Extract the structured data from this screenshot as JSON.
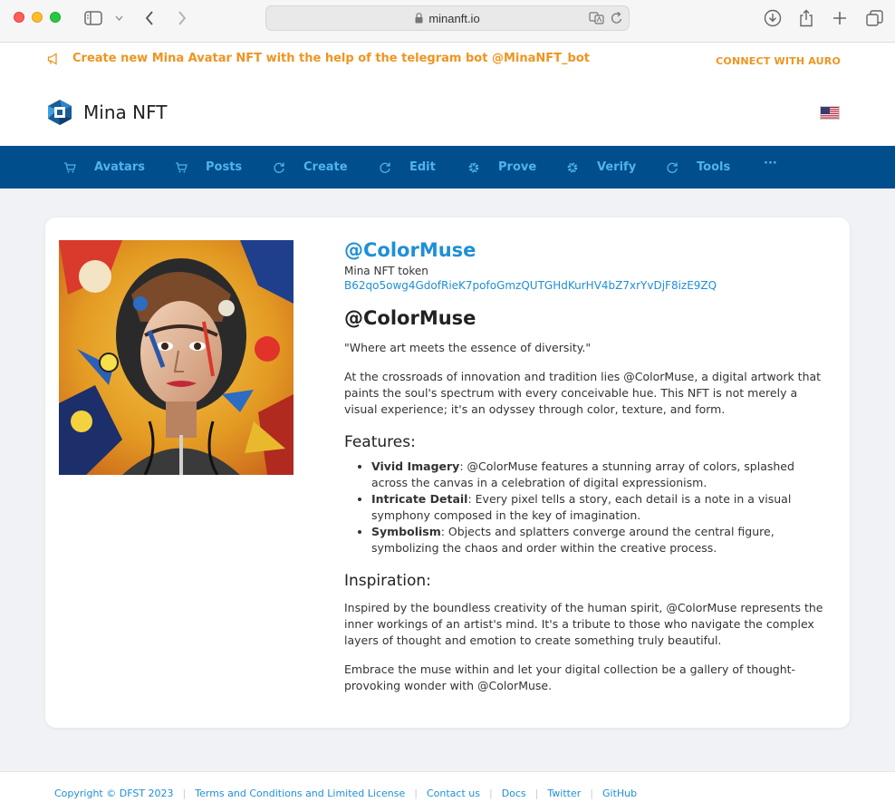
{
  "browser": {
    "url": "minanft.io"
  },
  "banner": {
    "announcement": "Create new Mina Avatar NFT with the help of the telegram bot @MinaNFT_bot",
    "connect_label": "CONNECT WITH AURO",
    "site_name": "Mina NFT"
  },
  "nav": {
    "items": [
      {
        "label": "Avatars",
        "icon": "cart-icon"
      },
      {
        "label": "Posts",
        "icon": "cart-icon"
      },
      {
        "label": "Create",
        "icon": "refresh-icon"
      },
      {
        "label": "Edit",
        "icon": "refresh-icon"
      },
      {
        "label": "Prove",
        "icon": "gear-icon"
      },
      {
        "label": "Verify",
        "icon": "gear-icon"
      },
      {
        "label": "Tools",
        "icon": "refresh-icon"
      }
    ],
    "more": "···"
  },
  "nft": {
    "handle_link": "@ColorMuse",
    "token_label": "Mina NFT token",
    "token_id": "B62qo5owg4GdofRieK7pofoGmzQUTGHdKurHV4bZ7xrYvDjF8izE9ZQ",
    "title": "@ColorMuse",
    "quote": "\"Where art meets the essence of diversity.\"",
    "intro": "At the crossroads of innovation and tradition lies @ColorMuse, a digital artwork that paints the soul's spectrum with every conceivable hue. This NFT is not merely a visual experience; it's an odyssey through color, texture, and form.",
    "features_heading": "Features:",
    "features": [
      {
        "title": "Vivid Imagery",
        "text": ": @ColorMuse features a stunning array of colors, splashed across the canvas in a celebration of digital expressionism."
      },
      {
        "title": "Intricate Detail",
        "text": ": Every pixel tells a story, each detail is a note in a visual symphony composed in the key of imagination."
      },
      {
        "title": "Symbolism",
        "text": ": Objects and splatters converge around the central figure, symbolizing the chaos and order within the creative process."
      }
    ],
    "inspiration_heading": "Inspiration:",
    "inspiration": "Inspired by the boundless creativity of the human spirit, @ColorMuse represents the inner workings of an artist's mind. It's a tribute to those who navigate the complex layers of thought and emotion to create something truly beautiful.",
    "embrace": "Embrace the muse within and let your digital collection be a gallery of thought-provoking wonder with @ColorMuse."
  },
  "footer": {
    "copyright": "Copyright © DFST 2023",
    "links": [
      "Terms and Conditions and Limited License",
      "Contact us",
      "Docs",
      "Twitter",
      "GitHub"
    ]
  },
  "colors": {
    "nav_bg": "#004e8b",
    "nav_text": "#4fb3ef",
    "accent_orange": "#f0941f",
    "link_blue": "#1f8fd7"
  }
}
